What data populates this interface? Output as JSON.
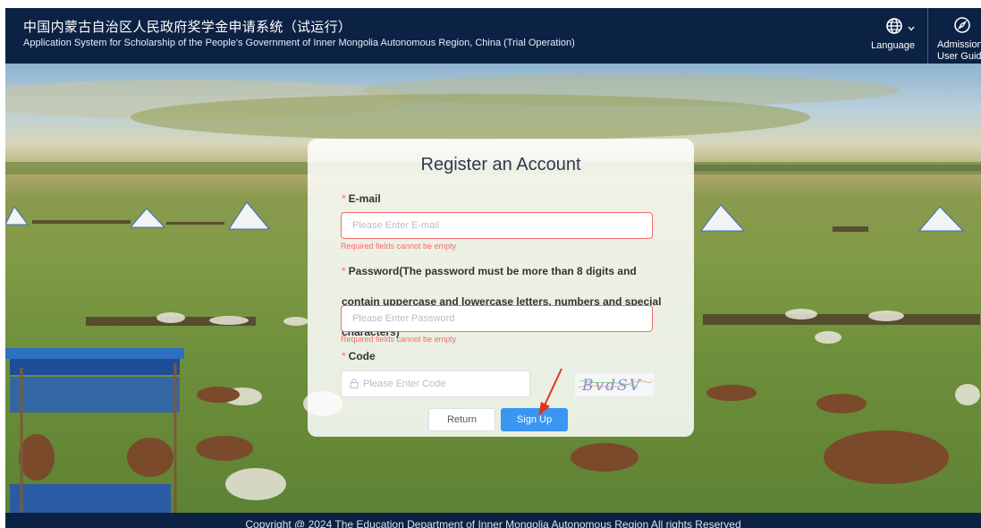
{
  "header": {
    "title_cn": "中国内蒙古自治区人民政府奖学金申请系统（试运行）",
    "title_en": "Application System for Scholarship of the People's Government of Inner Mongolia Autonomous Region, China (Trial Operation)",
    "language_label": "Language",
    "language_icon": "globe-icon",
    "guide_line1": "Admission",
    "guide_line2": "User Guide",
    "guide_icon": "compass-icon"
  },
  "form": {
    "title": "Register an Account",
    "email": {
      "label": "E-mail",
      "placeholder": "Please Enter E-mail",
      "value": "",
      "error": "Required fields cannot be empty"
    },
    "password": {
      "label": "Password(The password must be more than 8 digits and contain uppercase and lowercase letters, numbers and special characters)",
      "placeholder": "Please Enter Password",
      "value": "",
      "error": "Required fields cannot be empty"
    },
    "code": {
      "label": "Code",
      "placeholder": "Please Enter Code",
      "value": "",
      "captcha_text": "BvdSV"
    },
    "return_label": "Return",
    "signup_label": "Sign Up"
  },
  "footer": {
    "copyright": "Copyright @ 2024 The Education Department of Inner Mongolia Autonomous Region All rights Reserved"
  },
  "colors": {
    "header_bg": "#0b2244",
    "primary": "#3b96f3",
    "error": "#f56c6c",
    "annotation_arrow": "#e53020"
  }
}
